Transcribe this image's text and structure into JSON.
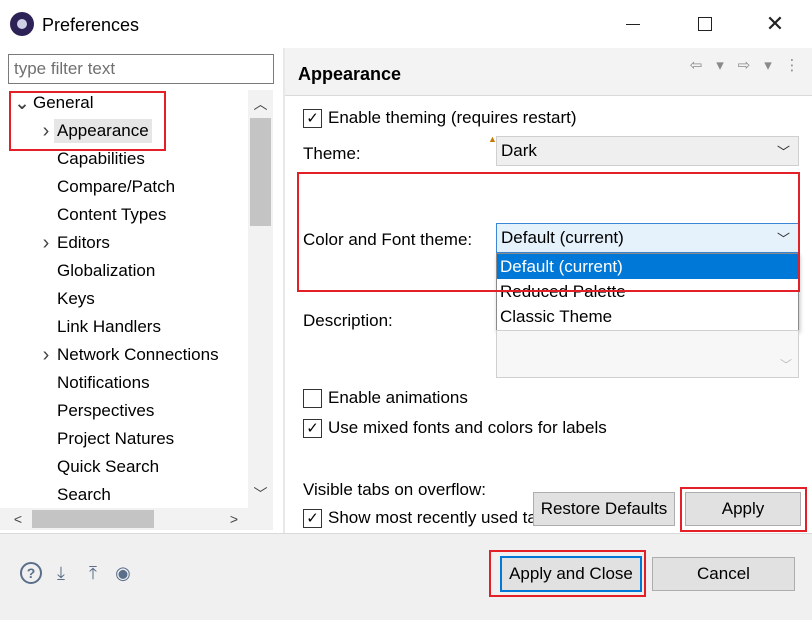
{
  "window": {
    "title": "Preferences",
    "close_glyph": "✕"
  },
  "left": {
    "filter_placeholder": "type filter text",
    "tree": [
      {
        "label": "General",
        "expand": "expanded",
        "level": 0
      },
      {
        "label": "Appearance",
        "expand": "collapsed",
        "level": 1,
        "selected": true
      },
      {
        "label": "Capabilities",
        "expand": "none",
        "level": 1
      },
      {
        "label": "Compare/Patch",
        "expand": "none",
        "level": 1
      },
      {
        "label": "Content Types",
        "expand": "none",
        "level": 1
      },
      {
        "label": "Editors",
        "expand": "collapsed",
        "level": 1
      },
      {
        "label": "Globalization",
        "expand": "none",
        "level": 1
      },
      {
        "label": "Keys",
        "expand": "none",
        "level": 1
      },
      {
        "label": "Link Handlers",
        "expand": "none",
        "level": 1
      },
      {
        "label": "Network Connections",
        "expand": "collapsed",
        "level": 1
      },
      {
        "label": "Notifications",
        "expand": "none",
        "level": 1
      },
      {
        "label": "Perspectives",
        "expand": "none",
        "level": 1
      },
      {
        "label": "Project Natures",
        "expand": "none",
        "level": 1
      },
      {
        "label": "Quick Search",
        "expand": "none",
        "level": 1
      },
      {
        "label": "Search",
        "expand": "none",
        "level": 1
      }
    ]
  },
  "page": {
    "title": "Appearance",
    "enable_theming": {
      "label": "Enable theming (requires restart)",
      "checked": true
    },
    "theme": {
      "label": "Theme:",
      "value": "Dark"
    },
    "color_font_theme": {
      "label": "Color and Font theme:",
      "value": "Default (current)",
      "options": [
        "Default (current)",
        "Reduced Palette",
        "Classic Theme"
      ],
      "highlighted_index": 0
    },
    "description": {
      "label": "Description:"
    },
    "enable_animations": {
      "label": "Enable animations",
      "checked": false
    },
    "mixed_fonts": {
      "label": "Use mixed fonts and colors for labels",
      "checked": true
    },
    "visible_tabs": {
      "label": "Visible tabs on overflow:"
    },
    "show_recent_tabs": {
      "label": "Show most recently used tabs",
      "checked": true
    },
    "restore_defaults": "Restore Defaults",
    "apply": "Apply"
  },
  "footer": {
    "apply_and_close": "Apply and Close",
    "cancel": "Cancel"
  },
  "colors": {
    "highlight_red": "#e32028",
    "selection_blue": "#0078d7"
  }
}
